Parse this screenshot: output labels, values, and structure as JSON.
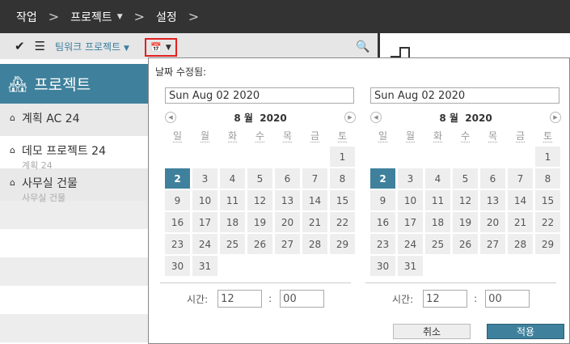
{
  "breadcrumb": [
    "작업",
    "프로젝트",
    "설정"
  ],
  "toolbar": {
    "view_label": "팀워크 프로젝트"
  },
  "sidebar": {
    "title": "프로젝트",
    "items": [
      {
        "title": "계획 AC 24",
        "sub": ""
      },
      {
        "title": "데모 프로젝트 24",
        "sub": "계획 24"
      },
      {
        "title": "사무실 건물",
        "sub": "사무실 건물"
      }
    ]
  },
  "popup": {
    "label": "날짜 수정됨:",
    "cancel": "취소",
    "apply": "적용",
    "time_label": "시간:",
    "calendars": [
      {
        "date_value": "Sun Aug 02 2020",
        "month": "8 월",
        "year": "2020",
        "hour": "12",
        "minute": "00",
        "first_weekday": 6,
        "days": 31,
        "selected": 2
      },
      {
        "date_value": "Sun Aug 02 2020",
        "month": "8 월",
        "year": "2020",
        "hour": "12",
        "minute": "00",
        "first_weekday": 6,
        "days": 31,
        "selected": 2
      }
    ],
    "weekdays": [
      "일",
      "월",
      "화",
      "수",
      "목",
      "금",
      "토"
    ]
  },
  "colors": {
    "accent": "#3f819c",
    "topbar": "#333333"
  }
}
